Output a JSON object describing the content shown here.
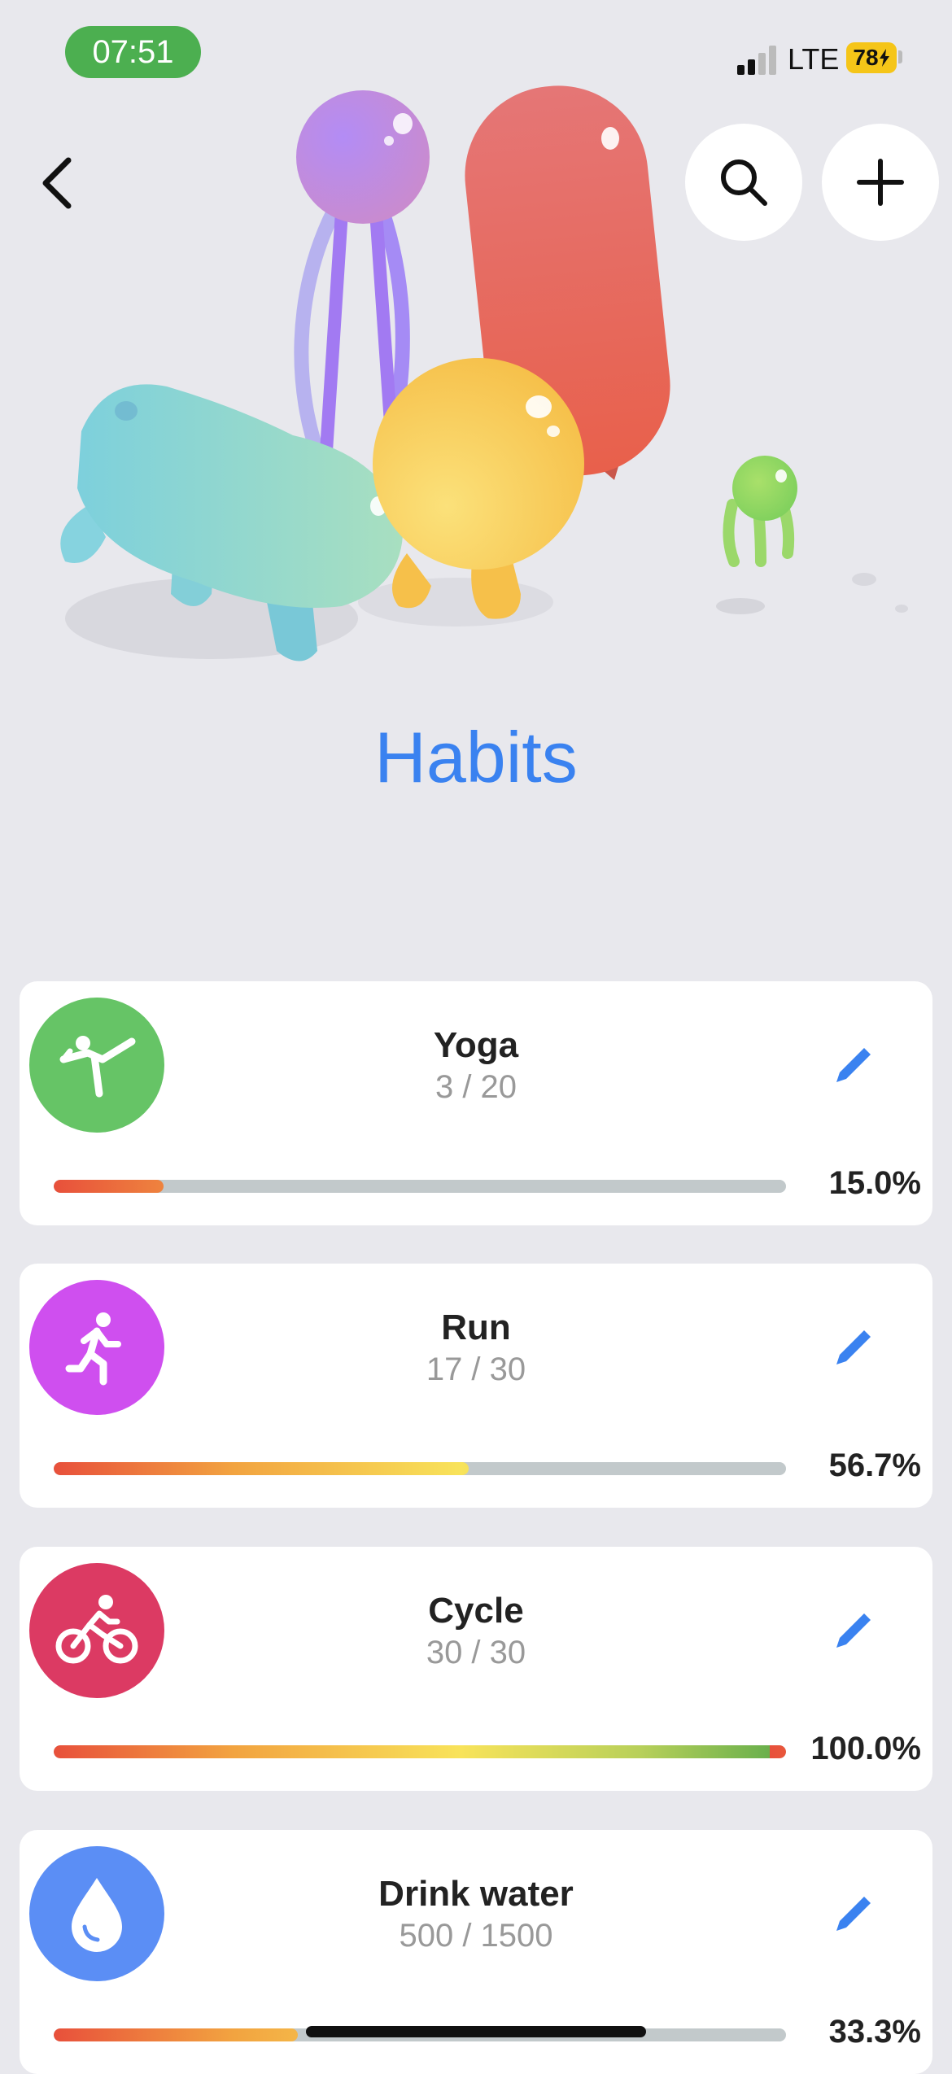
{
  "status_bar": {
    "time": "07:51",
    "network": "LTE",
    "battery": "78"
  },
  "header": {
    "title": "Habits"
  },
  "colors": {
    "accent": "#3a82f0",
    "time_pill": "#4caf50",
    "battery": "#f5c518"
  },
  "icons": {
    "back": "chevron-left-icon",
    "search": "search-icon",
    "add": "plus-icon",
    "edit": "pencil-icon"
  },
  "habits": [
    {
      "name": "Yoga",
      "count": "3 / 20",
      "percent": "15.0%",
      "progress": 0.15,
      "color": "#66c466",
      "icon": "yoga-icon"
    },
    {
      "name": "Run",
      "count": "17 / 30",
      "percent": "56.7%",
      "progress": 0.567,
      "color": "#cf4fef",
      "icon": "running-icon"
    },
    {
      "name": "Cycle",
      "count": "30 / 30",
      "percent": "100.0%",
      "progress": 1.0,
      "color": "#dc3a63",
      "icon": "bicycle-icon"
    },
    {
      "name": "Drink water",
      "count": "500 / 1500",
      "percent": "33.3%",
      "progress": 0.333,
      "color": "#5b8ef5",
      "icon": "water-drop-icon"
    }
  ]
}
